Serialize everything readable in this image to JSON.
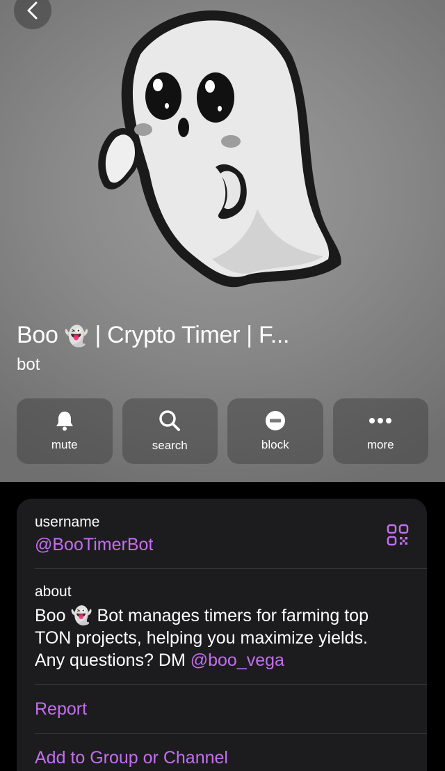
{
  "profile": {
    "name_prefix": "Boo",
    "name_emoji": "👻",
    "name_suffix": "| Crypto Timer | F...",
    "type": "bot"
  },
  "actions": {
    "mute": "mute",
    "search": "search",
    "block": "block",
    "more": "more"
  },
  "info": {
    "username_label": "username",
    "username_value": "@BooTimerBot",
    "about_label": "about",
    "about_prefix": "Boo",
    "about_emoji": "👻",
    "about_text": "Bot manages timers for farming top TON projects, helping you maximize yields. Any questions? DM",
    "about_mention": "@boo_vega",
    "report": "Report",
    "add_to_group": "Add to Group or Channel"
  },
  "colors": {
    "accent": "#c36ef0",
    "card_background": "#1c1c1e",
    "page_background": "#000000"
  },
  "icons": [
    "back-chevron-icon",
    "bell-icon",
    "search-icon",
    "block-icon",
    "more-dots-icon",
    "qr-code-icon"
  ]
}
